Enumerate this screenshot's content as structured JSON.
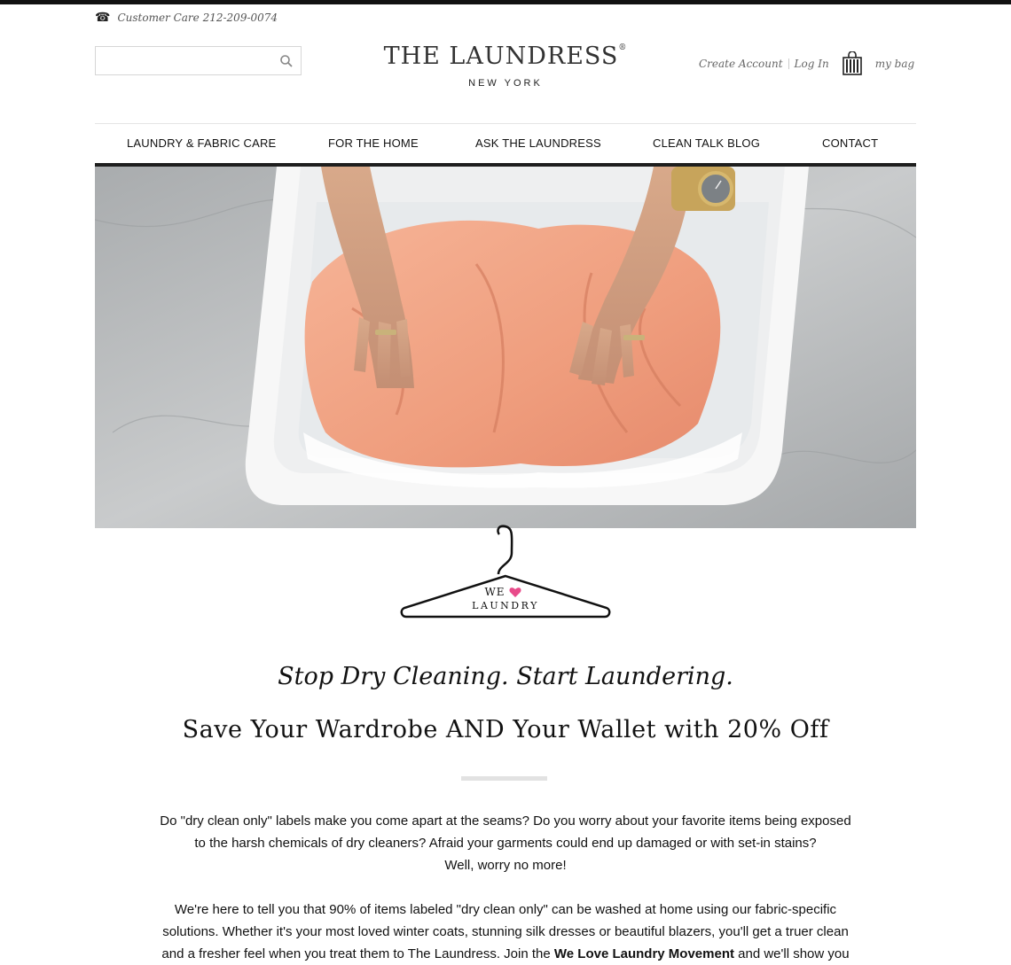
{
  "header": {
    "customer_care": "Customer Care 212-209-0074",
    "search_placeholder": "",
    "brand": "THE LAUNDRESS",
    "brand_mark": "®",
    "city": "NEW YORK",
    "create_account": "Create Account",
    "log_in": "Log In",
    "my_bag": "my bag"
  },
  "nav": {
    "items": [
      {
        "label": "LAUNDRY & FABRIC CARE"
      },
      {
        "label": "FOR THE HOME"
      },
      {
        "label": "ASK THE LAUNDRESS"
      },
      {
        "label": "CLEAN TALK BLOG"
      },
      {
        "label": "CONTACT"
      }
    ]
  },
  "hanger": {
    "line1": "WE",
    "line2": "LAUNDRY"
  },
  "main": {
    "tagline": "Stop Dry Cleaning. Start Laundering.",
    "headline": "Save Your Wardrobe AND Your Wallet with 20% Off",
    "para1": [
      "Do \"dry clean only\" labels make you come apart at the seams? Do you worry about your favorite items being exposed",
      "to the harsh chemicals of dry cleaners? Afraid your garments could end up damaged or with set-in stains?",
      "Well, worry no more!"
    ],
    "para2_line1": "We're here to tell you that 90% of items labeled \"dry clean only\" can be washed at home using our fabric-specific",
    "para2_line2": "solutions. Whether it's your most loved winter coats, stunning silk dresses or beautiful blazers, you'll get a truer clean",
    "para2_line3_a": "and a fresher feel when you treat them to The Laundress. Join the ",
    "para2_line3_b": "We Love Laundry Movement",
    "para2_line3_c": " and we'll show you"
  },
  "colors": {
    "heart": "#e84b8a",
    "towel": "#f2a585",
    "marble": "#b9bcbe",
    "nav_bar": "#1e1e1e"
  }
}
